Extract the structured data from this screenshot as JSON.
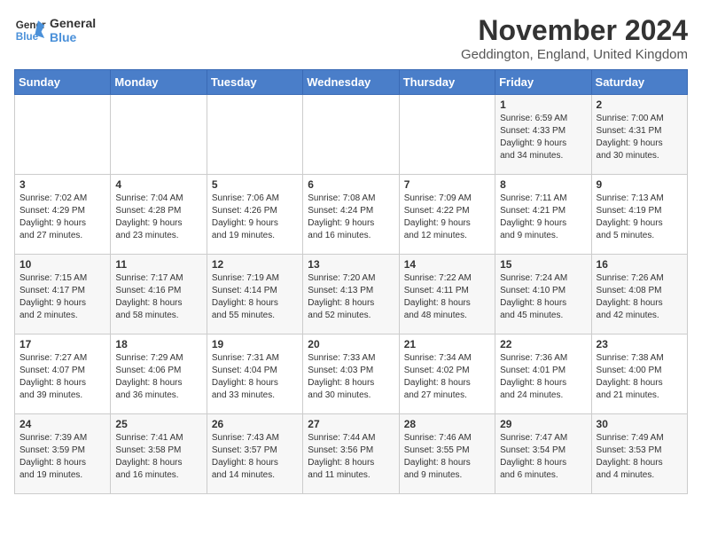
{
  "logo": {
    "line1": "General",
    "line2": "Blue"
  },
  "title": "November 2024",
  "subtitle": "Geddington, England, United Kingdom",
  "days_of_week": [
    "Sunday",
    "Monday",
    "Tuesday",
    "Wednesday",
    "Thursday",
    "Friday",
    "Saturday"
  ],
  "weeks": [
    [
      {
        "day": "",
        "info": ""
      },
      {
        "day": "",
        "info": ""
      },
      {
        "day": "",
        "info": ""
      },
      {
        "day": "",
        "info": ""
      },
      {
        "day": "",
        "info": ""
      },
      {
        "day": "1",
        "info": "Sunrise: 6:59 AM\nSunset: 4:33 PM\nDaylight: 9 hours\nand 34 minutes."
      },
      {
        "day": "2",
        "info": "Sunrise: 7:00 AM\nSunset: 4:31 PM\nDaylight: 9 hours\nand 30 minutes."
      }
    ],
    [
      {
        "day": "3",
        "info": "Sunrise: 7:02 AM\nSunset: 4:29 PM\nDaylight: 9 hours\nand 27 minutes."
      },
      {
        "day": "4",
        "info": "Sunrise: 7:04 AM\nSunset: 4:28 PM\nDaylight: 9 hours\nand 23 minutes."
      },
      {
        "day": "5",
        "info": "Sunrise: 7:06 AM\nSunset: 4:26 PM\nDaylight: 9 hours\nand 19 minutes."
      },
      {
        "day": "6",
        "info": "Sunrise: 7:08 AM\nSunset: 4:24 PM\nDaylight: 9 hours\nand 16 minutes."
      },
      {
        "day": "7",
        "info": "Sunrise: 7:09 AM\nSunset: 4:22 PM\nDaylight: 9 hours\nand 12 minutes."
      },
      {
        "day": "8",
        "info": "Sunrise: 7:11 AM\nSunset: 4:21 PM\nDaylight: 9 hours\nand 9 minutes."
      },
      {
        "day": "9",
        "info": "Sunrise: 7:13 AM\nSunset: 4:19 PM\nDaylight: 9 hours\nand 5 minutes."
      }
    ],
    [
      {
        "day": "10",
        "info": "Sunrise: 7:15 AM\nSunset: 4:17 PM\nDaylight: 9 hours\nand 2 minutes."
      },
      {
        "day": "11",
        "info": "Sunrise: 7:17 AM\nSunset: 4:16 PM\nDaylight: 8 hours\nand 58 minutes."
      },
      {
        "day": "12",
        "info": "Sunrise: 7:19 AM\nSunset: 4:14 PM\nDaylight: 8 hours\nand 55 minutes."
      },
      {
        "day": "13",
        "info": "Sunrise: 7:20 AM\nSunset: 4:13 PM\nDaylight: 8 hours\nand 52 minutes."
      },
      {
        "day": "14",
        "info": "Sunrise: 7:22 AM\nSunset: 4:11 PM\nDaylight: 8 hours\nand 48 minutes."
      },
      {
        "day": "15",
        "info": "Sunrise: 7:24 AM\nSunset: 4:10 PM\nDaylight: 8 hours\nand 45 minutes."
      },
      {
        "day": "16",
        "info": "Sunrise: 7:26 AM\nSunset: 4:08 PM\nDaylight: 8 hours\nand 42 minutes."
      }
    ],
    [
      {
        "day": "17",
        "info": "Sunrise: 7:27 AM\nSunset: 4:07 PM\nDaylight: 8 hours\nand 39 minutes."
      },
      {
        "day": "18",
        "info": "Sunrise: 7:29 AM\nSunset: 4:06 PM\nDaylight: 8 hours\nand 36 minutes."
      },
      {
        "day": "19",
        "info": "Sunrise: 7:31 AM\nSunset: 4:04 PM\nDaylight: 8 hours\nand 33 minutes."
      },
      {
        "day": "20",
        "info": "Sunrise: 7:33 AM\nSunset: 4:03 PM\nDaylight: 8 hours\nand 30 minutes."
      },
      {
        "day": "21",
        "info": "Sunrise: 7:34 AM\nSunset: 4:02 PM\nDaylight: 8 hours\nand 27 minutes."
      },
      {
        "day": "22",
        "info": "Sunrise: 7:36 AM\nSunset: 4:01 PM\nDaylight: 8 hours\nand 24 minutes."
      },
      {
        "day": "23",
        "info": "Sunrise: 7:38 AM\nSunset: 4:00 PM\nDaylight: 8 hours\nand 21 minutes."
      }
    ],
    [
      {
        "day": "24",
        "info": "Sunrise: 7:39 AM\nSunset: 3:59 PM\nDaylight: 8 hours\nand 19 minutes."
      },
      {
        "day": "25",
        "info": "Sunrise: 7:41 AM\nSunset: 3:58 PM\nDaylight: 8 hours\nand 16 minutes."
      },
      {
        "day": "26",
        "info": "Sunrise: 7:43 AM\nSunset: 3:57 PM\nDaylight: 8 hours\nand 14 minutes."
      },
      {
        "day": "27",
        "info": "Sunrise: 7:44 AM\nSunset: 3:56 PM\nDaylight: 8 hours\nand 11 minutes."
      },
      {
        "day": "28",
        "info": "Sunrise: 7:46 AM\nSunset: 3:55 PM\nDaylight: 8 hours\nand 9 minutes."
      },
      {
        "day": "29",
        "info": "Sunrise: 7:47 AM\nSunset: 3:54 PM\nDaylight: 8 hours\nand 6 minutes."
      },
      {
        "day": "30",
        "info": "Sunrise: 7:49 AM\nSunset: 3:53 PM\nDaylight: 8 hours\nand 4 minutes."
      }
    ]
  ]
}
